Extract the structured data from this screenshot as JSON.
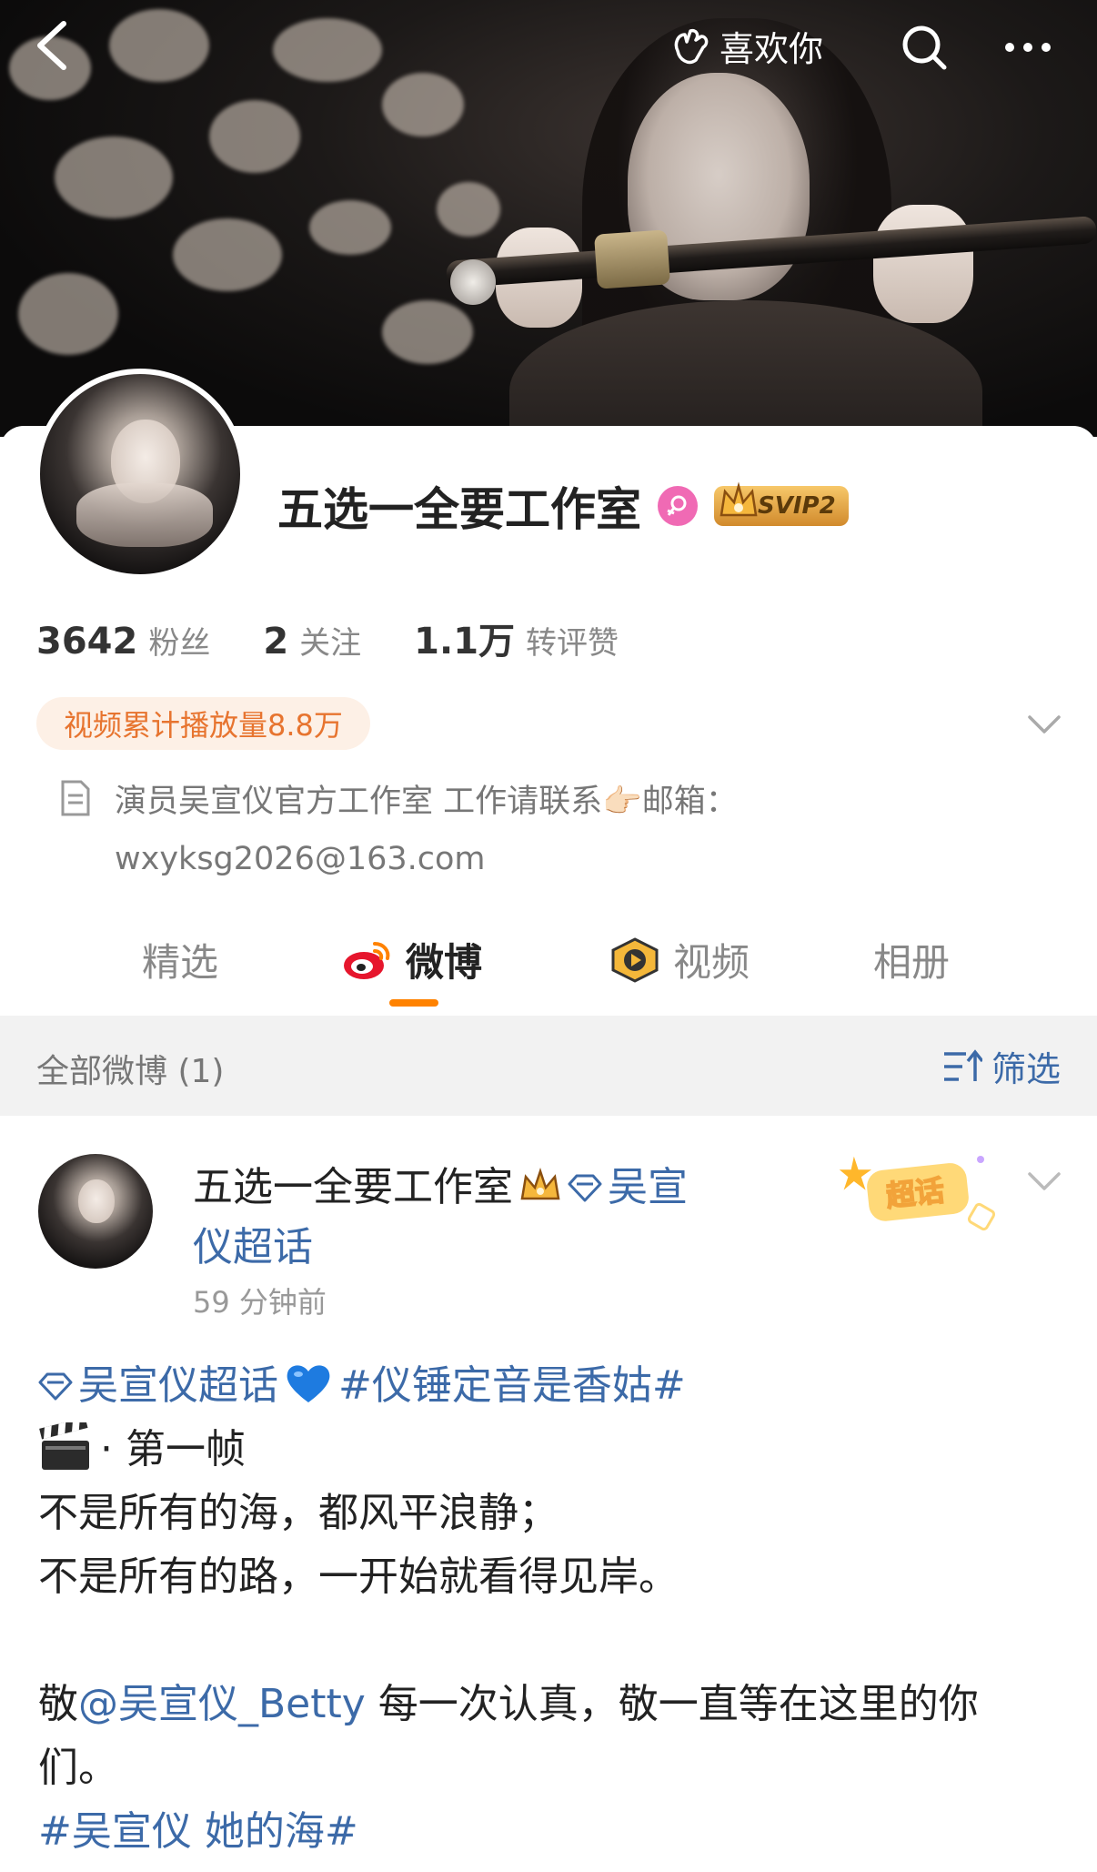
{
  "topbar": {
    "like_label": "喜欢你"
  },
  "profile": {
    "name": "五选一全要工作室",
    "badge_label": "SVIP2",
    "stats": [
      {
        "value": "3642",
        "label": "粉丝"
      },
      {
        "value": "2",
        "label": "关注"
      },
      {
        "value": "1.1万",
        "label": "转评赞"
      }
    ],
    "play_count": "视频累计播放量8.8万",
    "bio_line1": "演员吴宣仪官方工作室 工作请联系👉🏻邮箱：",
    "bio_line2": "wxyksg2026@163.com"
  },
  "tabs": [
    {
      "label": "精选"
    },
    {
      "label": "微博"
    },
    {
      "label": "视频"
    },
    {
      "label": "相册"
    }
  ],
  "filter": {
    "label": "全部微博 (1)",
    "button": "筛选"
  },
  "post": {
    "author": "五选一全要工作室",
    "topic_line1": "吴宣",
    "topic_line2": "仪超话",
    "time": "59 分钟前",
    "chaohua_badge": "超话",
    "body": {
      "topic": "吴宣仪超话",
      "hashtag1": "#仪锤定音是香姑#",
      "frame_text": "· 第一帧",
      "line1": "不是所有的海，都风平浪静；",
      "line2": "不是所有的路，一开始就看得见岸。",
      "line3_prefix": "敬",
      "mention": "@吴宣仪_Betty",
      "line3_suffix": " 每一次认真，敬一直等在这里的你",
      "line4": "们。",
      "hashtag2": "#吴宣仪 她的海#"
    }
  },
  "colors": {
    "accent": "#ff8200",
    "link": "#3c6aa8",
    "pill_bg": "#fdf0e6",
    "pill_text": "#e7742f"
  }
}
